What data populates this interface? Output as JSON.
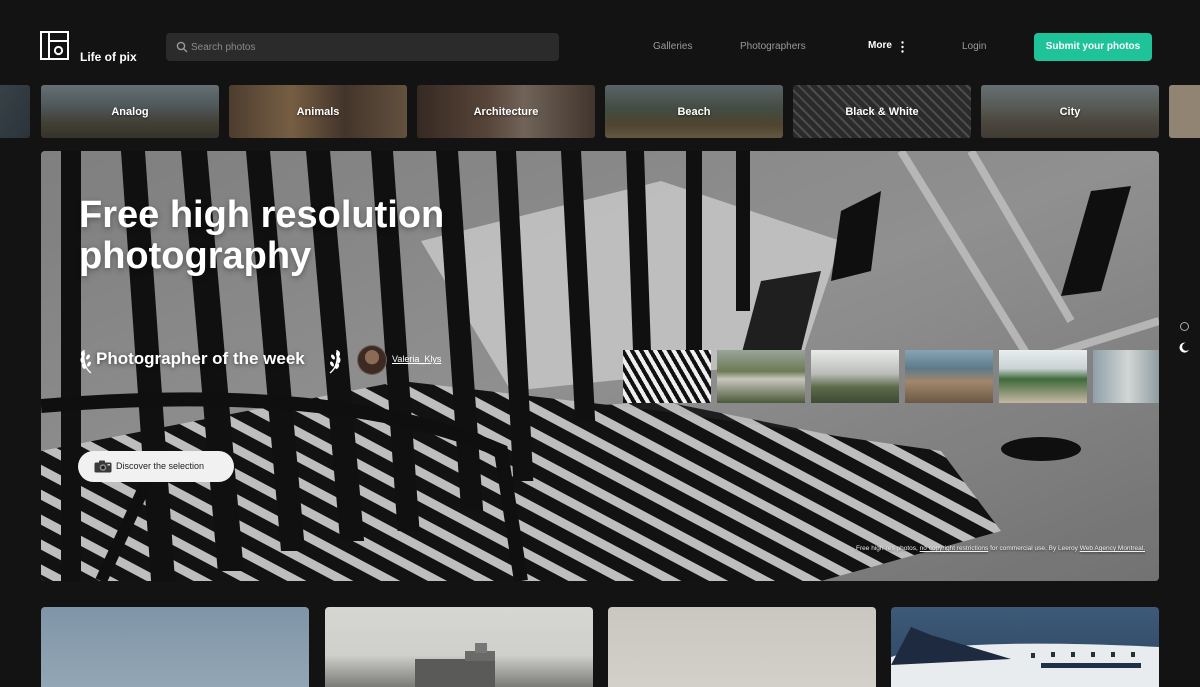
{
  "brand": {
    "name": "Life of pix"
  },
  "search": {
    "placeholder": "Search photos"
  },
  "nav": {
    "galleries": "Galleries",
    "photographers": "Photographers",
    "more": "More",
    "login": "Login",
    "submit": "Submit your photos"
  },
  "categories": [
    {
      "label": "Analog"
    },
    {
      "label": "Animals"
    },
    {
      "label": "Architecture"
    },
    {
      "label": "Beach"
    },
    {
      "label": "Black & White"
    },
    {
      "label": "City"
    }
  ],
  "hero": {
    "title": "Free high resolution photography",
    "potw_label": "Photographer of the week",
    "photographer": "Valeria_Klys",
    "discover": "Discover the selection",
    "credit": {
      "prefix": "Free high-res photos,",
      "link1": "no copyright restrictions",
      "middle": "for commercial use. By Leeroy",
      "link2": "Web Agency Montreal."
    }
  },
  "colors": {
    "background": "#131313",
    "accent": "#1fc39a",
    "search_bg": "#2b2b2b"
  }
}
